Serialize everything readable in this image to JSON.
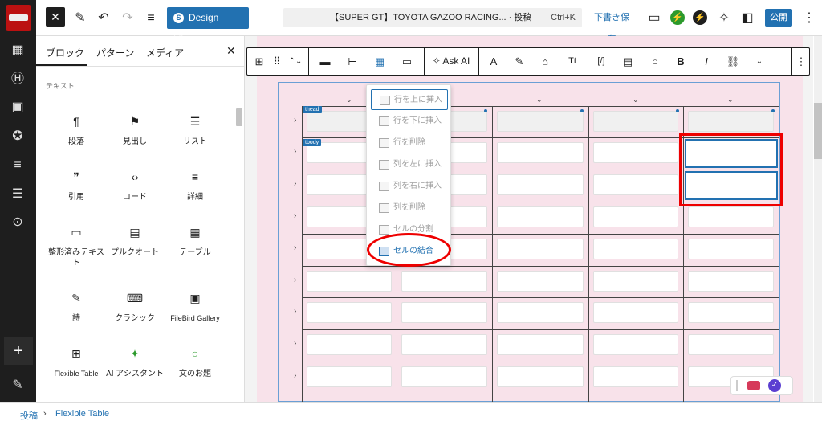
{
  "topbar": {
    "design_library": "Design Library",
    "search_text": "【SUPER GT】TOYOTA GAZOO RACING... · 投稿",
    "shortcut": "Ctrl+K",
    "save_draft": "下書き保存",
    "publish": "公開"
  },
  "panel": {
    "tabs": [
      "ブロック",
      "パターン",
      "メディア"
    ],
    "category": "テキスト",
    "blocks": [
      {
        "icon": "paragraph-icon",
        "glyph": "¶",
        "label": "段落"
      },
      {
        "icon": "heading-icon",
        "glyph": "⚑",
        "label": "見出し"
      },
      {
        "icon": "list-icon",
        "glyph": "☰",
        "label": "リスト"
      },
      {
        "icon": "quote-icon",
        "glyph": "❞",
        "label": "引用"
      },
      {
        "icon": "code-icon",
        "glyph": "‹›",
        "label": "コード"
      },
      {
        "icon": "details-icon",
        "glyph": "≡",
        "label": "詳細"
      },
      {
        "icon": "preformatted-icon",
        "glyph": "▭",
        "label": "整形済みテキスト"
      },
      {
        "icon": "pullquote-icon",
        "glyph": "▤",
        "label": "プルクオート"
      },
      {
        "icon": "table-icon",
        "glyph": "▦",
        "label": "テーブル"
      },
      {
        "icon": "verse-icon",
        "glyph": "✎",
        "label": "詩"
      },
      {
        "icon": "classic-icon",
        "glyph": "⌨",
        "label": "クラシック"
      },
      {
        "icon": "filebird-gallery-icon",
        "glyph": "▣",
        "label": "FileBird Gallery"
      },
      {
        "icon": "flexible-table-icon",
        "glyph": "⊞",
        "label": "Flexible Table"
      },
      {
        "icon": "ai-assistant-icon",
        "glyph": "✦",
        "label": "AI アシスタント"
      },
      {
        "icon": "prompt-icon",
        "glyph": "○",
        "label": "文のお題"
      }
    ]
  },
  "toolbar": {
    "ask_ai": "Ask AI",
    "bold": "B",
    "italic": "I"
  },
  "table": {
    "thead_tag": "thead",
    "tbody_tag": "tbody"
  },
  "context_menu": {
    "items": [
      "行を上に挿入",
      "行を下に挿入",
      "行を削除",
      "列を左に挿入",
      "列を右に挿入",
      "列を削除",
      "セルの分割",
      "セルの結合"
    ]
  },
  "breadcrumb": {
    "items": [
      "投稿",
      "Flexible Table"
    ]
  },
  "colors": {
    "accent": "#2271b1",
    "highlight": "#ee0000",
    "canvas_pink": "#f8e2ea"
  }
}
